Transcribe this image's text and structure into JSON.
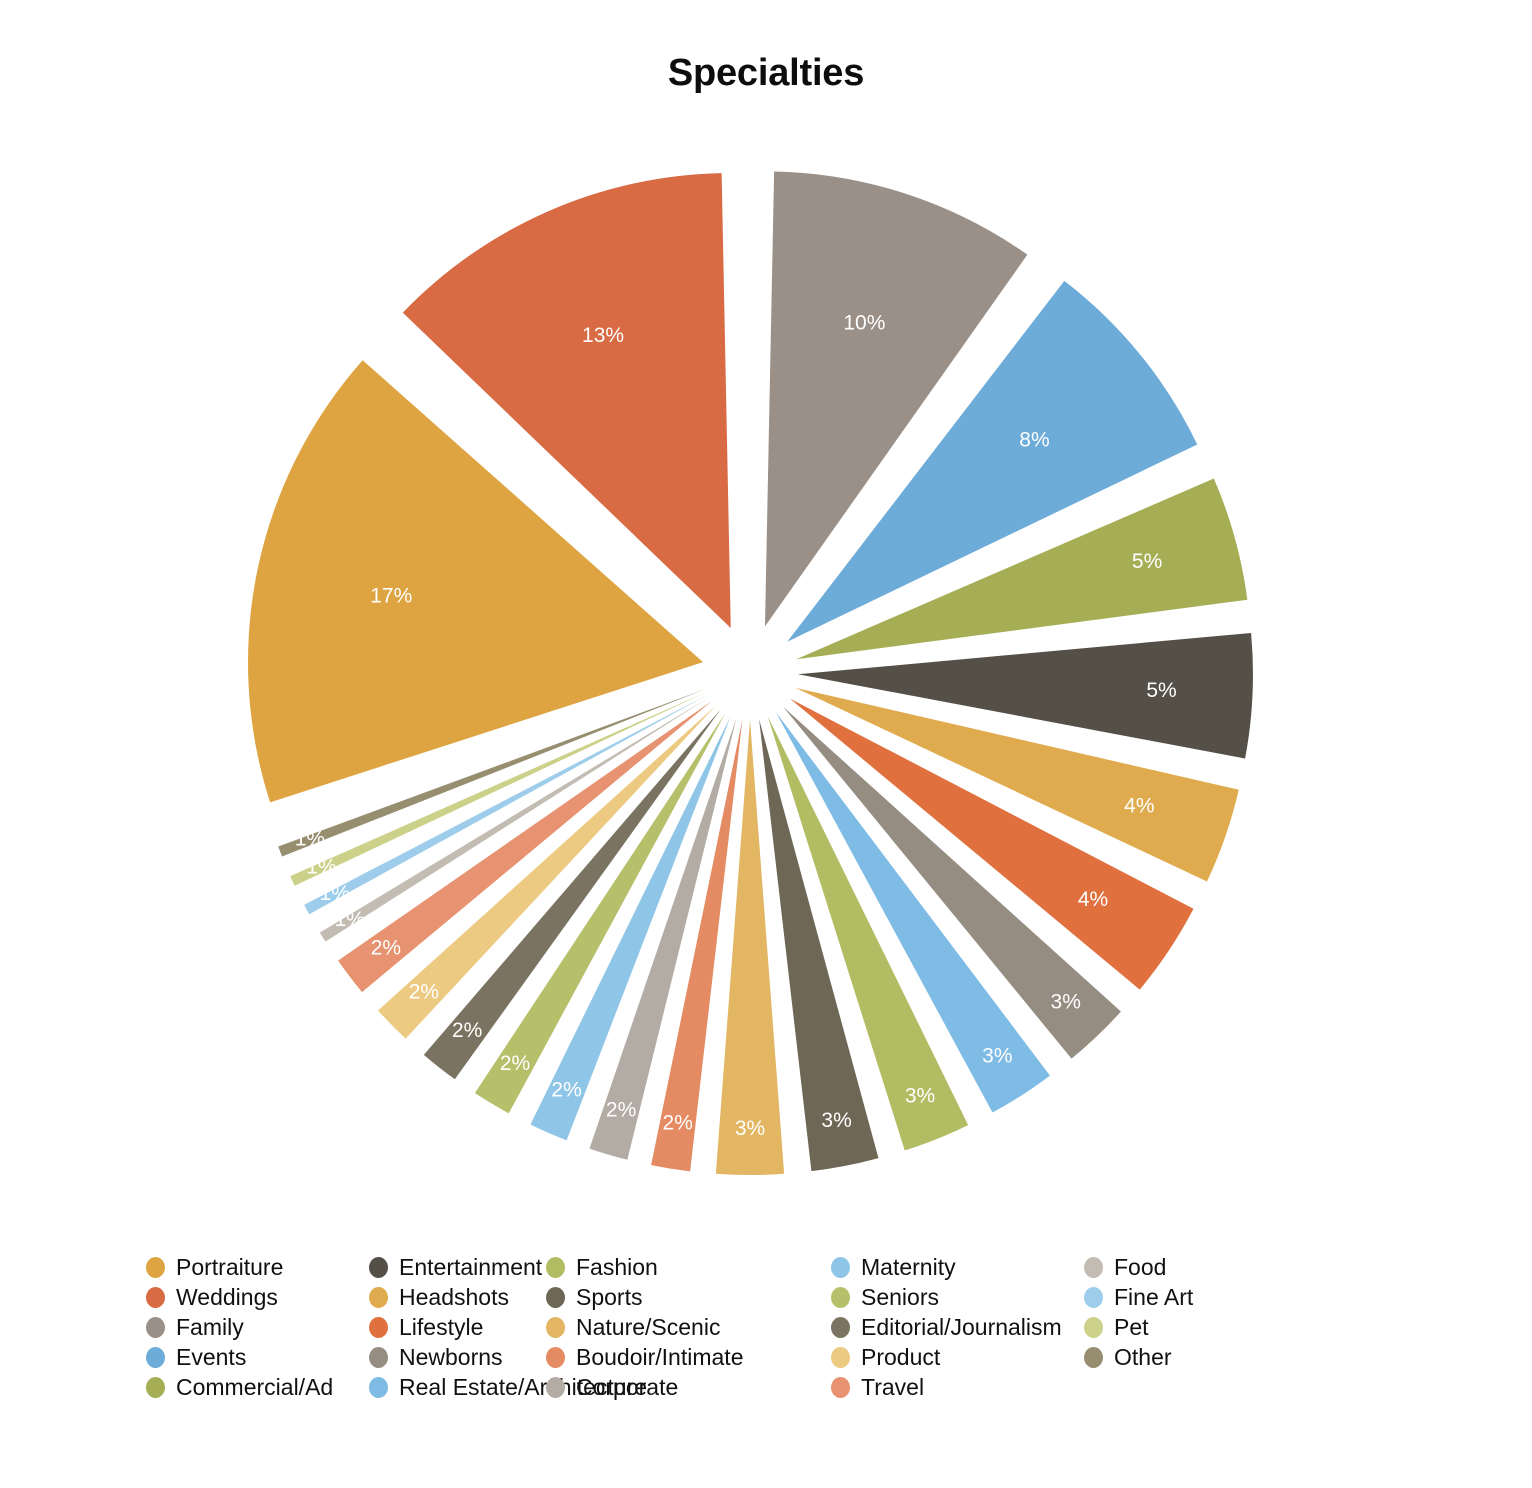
{
  "chart_data": {
    "type": "pie",
    "title": "Specialties",
    "xlabel": "",
    "ylabel": "",
    "legend_position": "bottom",
    "grid": false,
    "exploded": true,
    "label_format": "percent",
    "categories": [
      "Portraiture",
      "Weddings",
      "Family",
      "Events",
      "Commercial/Ad",
      "Entertainment",
      "Headshots",
      "Lifestyle",
      "Newborns",
      "Real Estate/Architecture",
      "Fashion",
      "Sports",
      "Nature/Scenic",
      "Boudoir/Intimate",
      "Corporate",
      "Maternity",
      "Seniors",
      "Editorial/Journalism",
      "Product",
      "Travel",
      "Food",
      "Fine Art",
      "Pet",
      "Other"
    ],
    "values": [
      17,
      13,
      10,
      8,
      5,
      5,
      4,
      4,
      3,
      3,
      3,
      3,
      3,
      2,
      2,
      2,
      2,
      2,
      2,
      2,
      1,
      1,
      1,
      1
    ],
    "labels": [
      "17%",
      "13%",
      "10%",
      "8%",
      "5%",
      "5%",
      "4%",
      "4%",
      "3%",
      "3%",
      "3%",
      "3%",
      "3%",
      "2%",
      "2%",
      "2%",
      "2%",
      "2%",
      "2%",
      "2%",
      "1%",
      "1%",
      "1%",
      "1%"
    ],
    "colors": [
      "#dda441",
      "#d86a44",
      "#9b9087",
      "#6dabd9",
      "#a5ae55",
      "#544f47",
      "#e0ab4e",
      "#e0713f",
      "#958c82",
      "#7ebbe5",
      "#b2bc62",
      "#6e6755",
      "#e2b663",
      "#e48b63",
      "#b3aca4",
      "#8fc6e8",
      "#b6c06b",
      "#7a7361",
      "#ecca81",
      "#e79270",
      "#c3bcb3",
      "#9dcdea",
      "#ccd18a",
      "#978e70"
    ],
    "slice_order_clockwise_from_top": [
      {
        "name": "Family",
        "pct": 10,
        "label": "10%",
        "color": "#9b9087"
      },
      {
        "name": "Events",
        "pct": 8,
        "label": "8%",
        "color": "#6dabd9"
      },
      {
        "name": "Commercial/Ad",
        "pct": 5,
        "label": "5%",
        "color": "#a5ae55"
      },
      {
        "name": "Entertainment",
        "pct": 5,
        "label": "5%",
        "color": "#544f47"
      },
      {
        "name": "Headshots",
        "pct": 4,
        "label": "4%",
        "color": "#e0ab4e"
      },
      {
        "name": "Lifestyle",
        "pct": 4,
        "label": "4%",
        "color": "#e0713f"
      },
      {
        "name": "Newborns",
        "pct": 3,
        "label": "3%",
        "color": "#958c82"
      },
      {
        "name": "Real Estate/Architecture",
        "pct": 3,
        "label": "3%",
        "color": "#7ebbe5"
      },
      {
        "name": "Fashion",
        "pct": 3,
        "label": "3%",
        "color": "#b2bc62"
      },
      {
        "name": "Sports",
        "pct": 3,
        "label": "3%",
        "color": "#6e6755"
      },
      {
        "name": "Nature/Scenic",
        "pct": 3,
        "label": "3%",
        "color": "#e2b663"
      },
      {
        "name": "Boudoir/Intimate",
        "pct": 2,
        "label": "2%",
        "color": "#e48b63"
      },
      {
        "name": "Corporate",
        "pct": 2,
        "label": "2%",
        "color": "#b3aca4"
      },
      {
        "name": "Maternity",
        "pct": 2,
        "label": "2%",
        "color": "#8fc6e8"
      },
      {
        "name": "Seniors",
        "pct": 2,
        "label": "2%",
        "color": "#b6c06b"
      },
      {
        "name": "Editorial/Journalism",
        "pct": 2,
        "label": "2%",
        "color": "#7a7361"
      },
      {
        "name": "Product",
        "pct": 2,
        "label": "2%",
        "color": "#ecca81"
      },
      {
        "name": "Travel",
        "pct": 2,
        "label": "2%",
        "color": "#e79270"
      },
      {
        "name": "Food",
        "pct": 1,
        "label": "1%",
        "color": "#c3bcb3"
      },
      {
        "name": "Fine Art",
        "pct": 1,
        "label": "1%",
        "color": "#9dcdea"
      },
      {
        "name": "Pet",
        "pct": 1,
        "label": "1%",
        "color": "#ccd18a"
      },
      {
        "name": "Other",
        "pct": 1,
        "label": "1%",
        "color": "#978e70"
      },
      {
        "name": "Portraiture",
        "pct": 17,
        "label": "17%",
        "color": "#dda441"
      },
      {
        "name": "Weddings",
        "pct": 13,
        "label": "13%",
        "color": "#d86a44"
      }
    ]
  },
  "legend": {
    "items": [
      {
        "label": "Portraiture",
        "color": "#dda441"
      },
      {
        "label": "Weddings",
        "color": "#d86a44"
      },
      {
        "label": "Family",
        "color": "#9b9087"
      },
      {
        "label": "Events",
        "color": "#6dabd9"
      },
      {
        "label": "Commercial/Ad",
        "color": "#a5ae55"
      },
      {
        "label": "Entertainment",
        "color": "#544f47"
      },
      {
        "label": "Headshots",
        "color": "#e0ab4e"
      },
      {
        "label": "Lifestyle",
        "color": "#e0713f"
      },
      {
        "label": "Newborns",
        "color": "#958c82"
      },
      {
        "label": "Real Estate/Architecture",
        "color": "#7ebbe5"
      },
      {
        "label": "Fashion",
        "color": "#b2bc62"
      },
      {
        "label": "Sports",
        "color": "#6e6755"
      },
      {
        "label": "Nature/Scenic",
        "color": "#e2b663"
      },
      {
        "label": "Boudoir/Intimate",
        "color": "#e48b63"
      },
      {
        "label": "Corporate",
        "color": "#b3aca4"
      },
      {
        "label": "Maternity",
        "color": "#8fc6e8"
      },
      {
        "label": "Seniors",
        "color": "#b6c06b"
      },
      {
        "label": "Editorial/Journalism",
        "color": "#7a7361"
      },
      {
        "label": "Product",
        "color": "#ecca81"
      },
      {
        "label": "Travel",
        "color": "#e79270"
      },
      {
        "label": "Food",
        "color": "#c3bcb3"
      },
      {
        "label": "Fine Art",
        "color": "#9dcdea"
      },
      {
        "label": "Pet",
        "color": "#ccd18a"
      },
      {
        "label": "Other",
        "color": "#978e70"
      }
    ]
  }
}
